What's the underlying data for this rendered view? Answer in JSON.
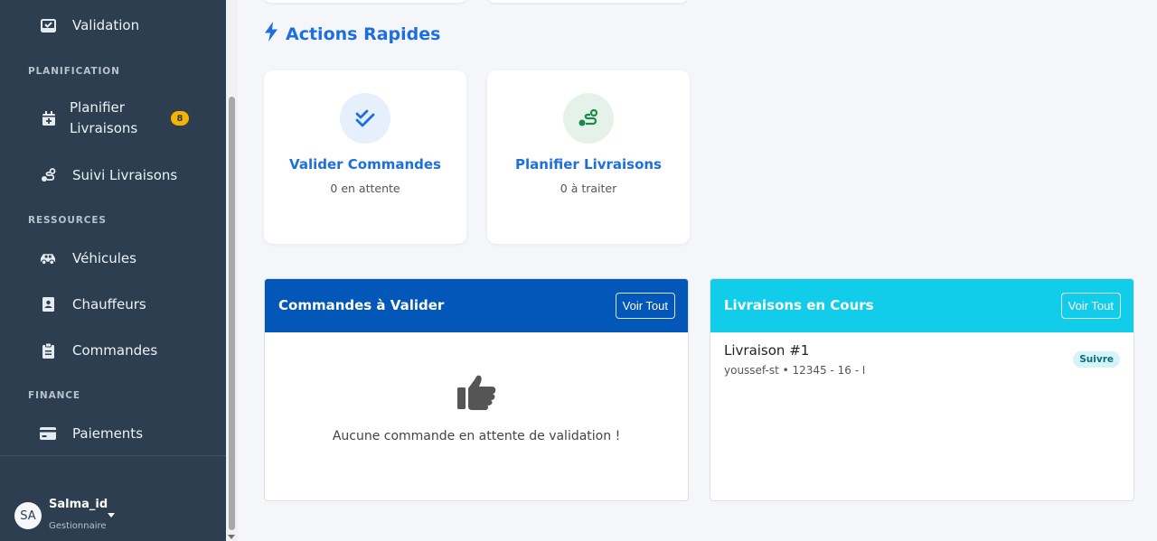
{
  "sidebar": {
    "items": {
      "validation": "Validation",
      "planifier_line1": "Planifier",
      "planifier_line2": "Livraisons",
      "planifier_badge": "8",
      "suivi": "Suivi Livraisons",
      "vehicules": "Véhicules",
      "chauffeurs": "Chauffeurs",
      "commandes": "Commandes",
      "paiements": "Paiements"
    },
    "sections": {
      "planification": "PLANIFICATION",
      "ressources": "RESSOURCES",
      "finance": "FINANCE"
    },
    "user": {
      "initials": "SA",
      "name": "Salma_id",
      "role": "Gestionnaire"
    }
  },
  "quick_actions": {
    "title": "Actions Rapides",
    "cards": [
      {
        "title": "Valider Commandes",
        "subtitle": "0 en attente",
        "icon": "double-check-icon"
      },
      {
        "title": "Planifier Livraisons",
        "subtitle": "0 à traiter",
        "icon": "route-icon"
      }
    ]
  },
  "panels": {
    "commandes": {
      "title": "Commandes à Valider",
      "button": "Voir Tout",
      "empty_message": "Aucune commande en attente de validation !",
      "header_color": "#0257b8"
    },
    "livraisons": {
      "title": "Livraisons en Cours",
      "button": "Voir Tout",
      "header_color": "#12cdea",
      "items": [
        {
          "title": "Livraison #1",
          "details": "youssef-st • 12345 - 16 - ا",
          "action": "Suivre"
        }
      ]
    }
  },
  "colors": {
    "sidebar_bg": "#2c3e50",
    "accent": "#1d6fe0",
    "badge": "#f4b400"
  }
}
